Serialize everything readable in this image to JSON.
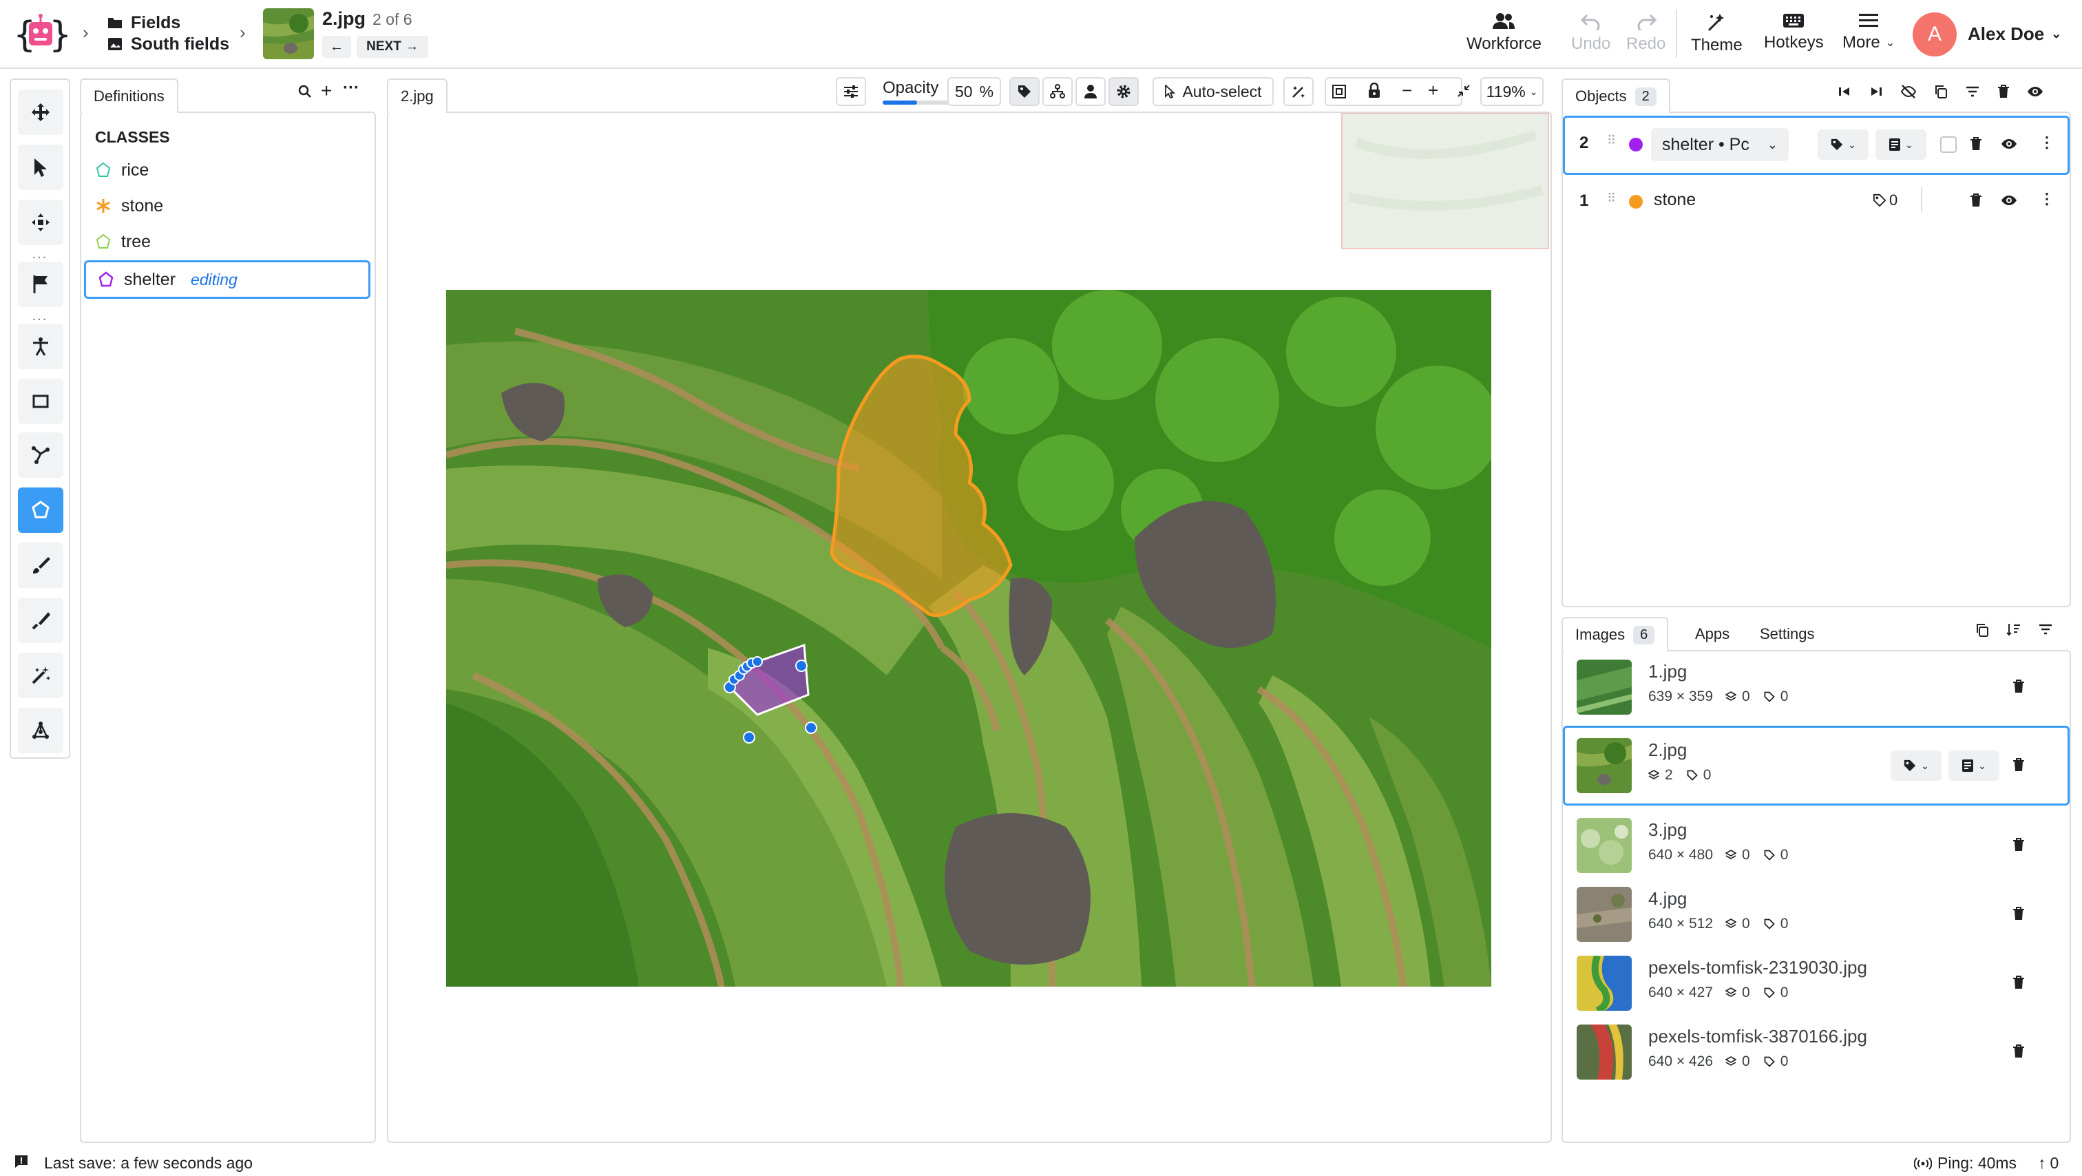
{
  "header": {
    "breadcrumb_project": "Fields",
    "breadcrumb_dataset": "South fields",
    "image_name": "2.jpg",
    "image_position": "2 of 6",
    "next_label": "NEXT",
    "actions": {
      "workforce": "Workforce",
      "undo": "Undo",
      "redo": "Redo",
      "theme": "Theme",
      "hotkeys": "Hotkeys",
      "more": "More"
    },
    "user": {
      "initial": "A",
      "name": "Alex Doe",
      "avatar_color": "#f4736b"
    }
  },
  "definitions": {
    "tab_label": "Definitions",
    "classes_heading": "CLASSES",
    "classes": [
      {
        "name": "rice",
        "shape": "polygon",
        "color": "#2ec4a0"
      },
      {
        "name": "stone",
        "shape": "point",
        "color": "#f59b1f"
      },
      {
        "name": "tree",
        "shape": "polygon",
        "color": "#8bd14a"
      },
      {
        "name": "shelter",
        "shape": "polygon",
        "color": "#a020f0",
        "state": "editing"
      }
    ]
  },
  "canvas": {
    "tab_label": "2.jpg",
    "opacity_label": "Opacity",
    "opacity_value": "50",
    "opacity_unit": "%",
    "auto_select_label": "Auto-select",
    "zoom_label": "119%"
  },
  "objects": {
    "tab_label": "Objects",
    "count": "2",
    "items": [
      {
        "index": "1",
        "name": "stone",
        "color": "#f59b1f",
        "tags": "0"
      },
      {
        "index": "2",
        "name": "shelter • Pc",
        "color": "#a020f0"
      }
    ]
  },
  "images": {
    "tab_label": "Images",
    "count": "6",
    "apps_tab": "Apps",
    "settings_tab": "Settings",
    "items": [
      {
        "name": "1.jpg",
        "dims": "639 × 359",
        "objects": "0",
        "tags": "0"
      },
      {
        "name": "2.jpg",
        "objects": "2",
        "tags": "0",
        "selected": true
      },
      {
        "name": "3.jpg",
        "dims": "640 × 480",
        "objects": "0",
        "tags": "0"
      },
      {
        "name": "4.jpg",
        "dims": "640 × 512",
        "objects": "0",
        "tags": "0"
      },
      {
        "name": "pexels-tomfisk-2319030.jpg",
        "dims": "640 × 427",
        "objects": "0",
        "tags": "0"
      },
      {
        "name": "pexels-tomfisk-3870166.jpg",
        "dims": "640 × 426",
        "objects": "0",
        "tags": "0"
      }
    ]
  },
  "status": {
    "last_save": "Last save: a few seconds ago",
    "ping": "Ping: 40ms",
    "uploads": "0"
  },
  "colors": {
    "accent": "#1a73e8",
    "active_tool": "#3b9cf5",
    "stone": "#f59b1f",
    "shelter": "#a020f0"
  }
}
